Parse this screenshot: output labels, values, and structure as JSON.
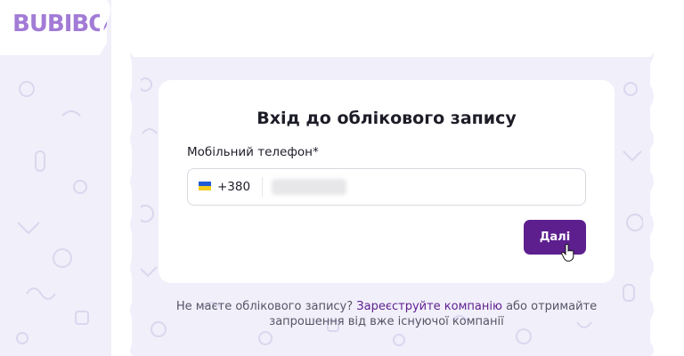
{
  "brand": {
    "logo_text": "BUBIBO"
  },
  "login": {
    "title": "Вхід до облікового запису",
    "phone_label": "Мобільний телефон*",
    "country_prefix": "+380",
    "next_button": "Далі"
  },
  "footer": {
    "prefix": "Не маєте облікового запису?",
    "register_link": "Зареєструйте компанію",
    "suffix": "або отримайте запрошення від вже існуючої компанії"
  },
  "colors": {
    "accent": "#5d1f8e",
    "logo": "#a27bd6",
    "background": "#f1effa"
  }
}
